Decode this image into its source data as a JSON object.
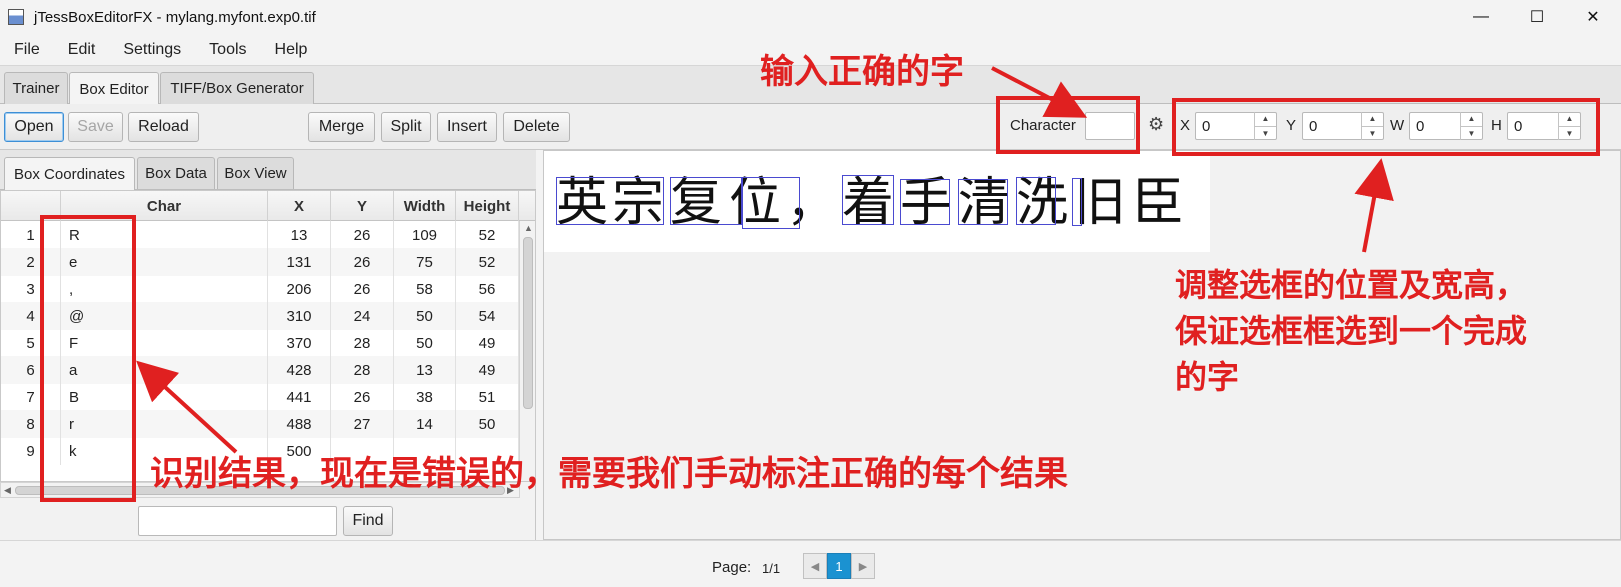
{
  "window": {
    "title": "jTessBoxEditorFX - mylang.myfont.exp0.tif",
    "controls": [
      "—",
      "☐",
      "✕"
    ]
  },
  "menu": [
    "File",
    "Edit",
    "Settings",
    "Tools",
    "Help"
  ],
  "top_tabs": [
    "Trainer",
    "Box Editor",
    "TIFF/Box Generator"
  ],
  "toolbar": {
    "open": "Open",
    "save": "Save",
    "reload": "Reload",
    "merge": "Merge",
    "split": "Split",
    "insert": "Insert",
    "delete": "Delete",
    "character_label": "Character",
    "character_value": "",
    "x_label": "X",
    "x_value": "0",
    "y_label": "Y",
    "y_value": "0",
    "w_label": "W",
    "w_value": "0",
    "h_label": "H",
    "h_value": "0"
  },
  "sub_tabs": [
    "Box Coordinates",
    "Box Data",
    "Box View"
  ],
  "table": {
    "headers": [
      "",
      "Char",
      "X",
      "Y",
      "Width",
      "Height"
    ],
    "rows": [
      [
        "1",
        "R",
        "13",
        "26",
        "109",
        "52"
      ],
      [
        "2",
        "e",
        "131",
        "26",
        "75",
        "52"
      ],
      [
        "3",
        ",",
        "206",
        "26",
        "58",
        "56"
      ],
      [
        "4",
        "@",
        "310",
        "24",
        "50",
        "54"
      ],
      [
        "5",
        "F",
        "370",
        "28",
        "50",
        "49"
      ],
      [
        "6",
        "a",
        "428",
        "28",
        "13",
        "49"
      ],
      [
        "7",
        "B",
        "441",
        "26",
        "38",
        "51"
      ],
      [
        "8",
        "r",
        "488",
        "27",
        "14",
        "50"
      ],
      [
        "9",
        "k",
        "500",
        "",
        "",
        ""
      ]
    ]
  },
  "find": {
    "value": "",
    "button": "Find"
  },
  "image_text": [
    "英",
    "宗",
    "复",
    "位",
    "，",
    "着",
    "手",
    "清",
    "洗",
    "旧",
    "臣"
  ],
  "status": {
    "page_label": "Page:",
    "page_count": "1/1",
    "current_page": "1"
  },
  "annotations": {
    "input_char": "输入正确的字",
    "adjust_box": [
      "调整选框的位置及宽高，",
      "保证选框框选到一个完成",
      "的字"
    ],
    "recognition": "识别结果，现在是错误的，需要我们手动标注正确的每个结果"
  },
  "colors": {
    "annotation": "#e02020",
    "box": "#4a4ad0",
    "page_current": "#1b92d1"
  }
}
